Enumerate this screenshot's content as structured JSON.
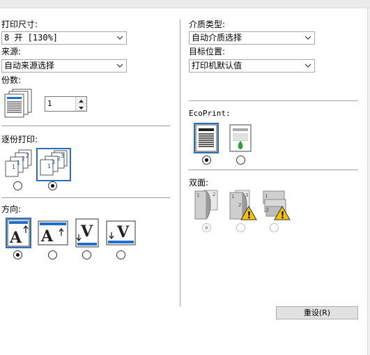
{
  "left": {
    "paper_size": {
      "label": "打印尺寸:",
      "value": "8 开  [130%]"
    },
    "source": {
      "label": "来源:",
      "value": "自动来源选择"
    },
    "copies": {
      "label": "份数:",
      "value": "1"
    },
    "collate": {
      "label": "逐份打印:"
    },
    "orientation": {
      "label": "方向:"
    }
  },
  "right": {
    "media_type": {
      "label": "介质类型:",
      "value": "自动介质选择"
    },
    "destination": {
      "label": "目标位置:",
      "value": "打印机默认值"
    },
    "ecoprint": {
      "label": "EcoPrint:"
    },
    "duplex": {
      "label": "双面:"
    },
    "reset_button": "重设(R)"
  },
  "colors": {
    "selection_border": "#2a6fb7",
    "accent_blue": "#1f6fcf",
    "warning_yellow": "#f5c400",
    "eco_green": "#2f9e3a"
  }
}
